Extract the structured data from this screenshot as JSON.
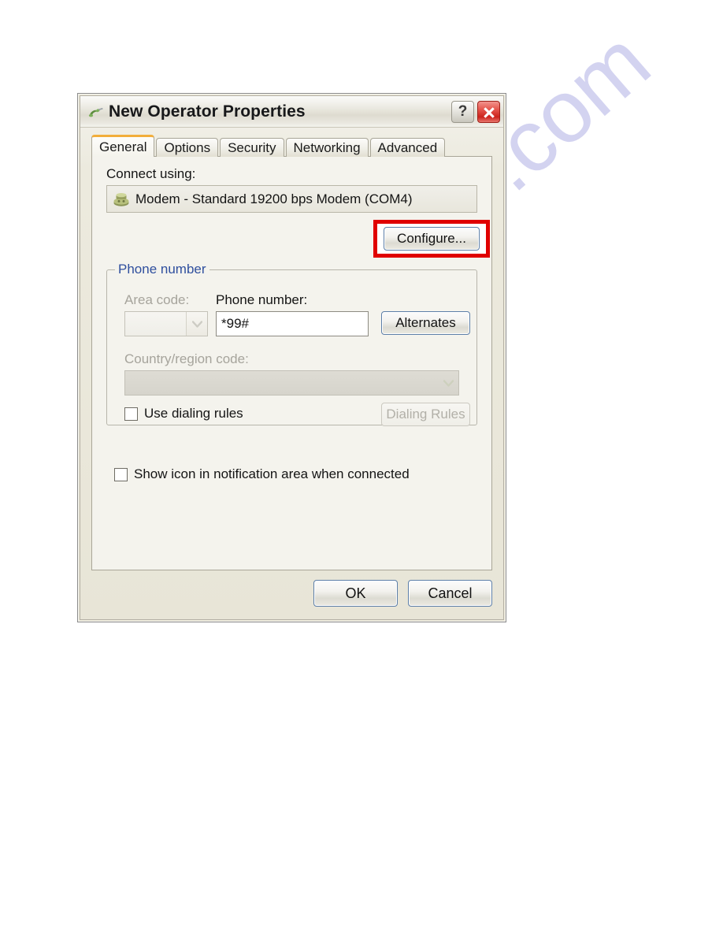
{
  "watermark": {
    "text": "manualshive.com"
  },
  "window": {
    "title": "New Operator Properties",
    "icon": "phone-handset-icon",
    "help_label": "?",
    "close_label": "✕"
  },
  "tabs": [
    {
      "label": "General",
      "active": true
    },
    {
      "label": "Options",
      "active": false
    },
    {
      "label": "Security",
      "active": false
    },
    {
      "label": "Networking",
      "active": false
    },
    {
      "label": "Advanced",
      "active": false
    }
  ],
  "general": {
    "connect_using_label": "Connect using:",
    "device": {
      "icon": "modem-icon",
      "name": "Modem - Standard 19200 bps Modem (COM4)"
    },
    "configure_button": "Configure...",
    "highlight_color": "#e00000",
    "phone_group": {
      "title": "Phone number",
      "area_code_label": "Area code:",
      "area_code_value": "",
      "area_code_disabled": true,
      "phone_number_label": "Phone number:",
      "phone_number_value": "*99#",
      "phone_number_placeholder": "",
      "alternates_button": "Alternates",
      "country_label": "Country/region code:",
      "country_value": "",
      "country_disabled": true,
      "use_dialing_rules_label": "Use dialing rules",
      "use_dialing_rules_checked": false,
      "dialing_rules_button": "Dialing Rules",
      "dialing_rules_disabled": true
    },
    "show_icon_label": "Show icon in notification area when connected",
    "show_icon_checked": false
  },
  "footer": {
    "ok_label": "OK",
    "cancel_label": "Cancel"
  }
}
